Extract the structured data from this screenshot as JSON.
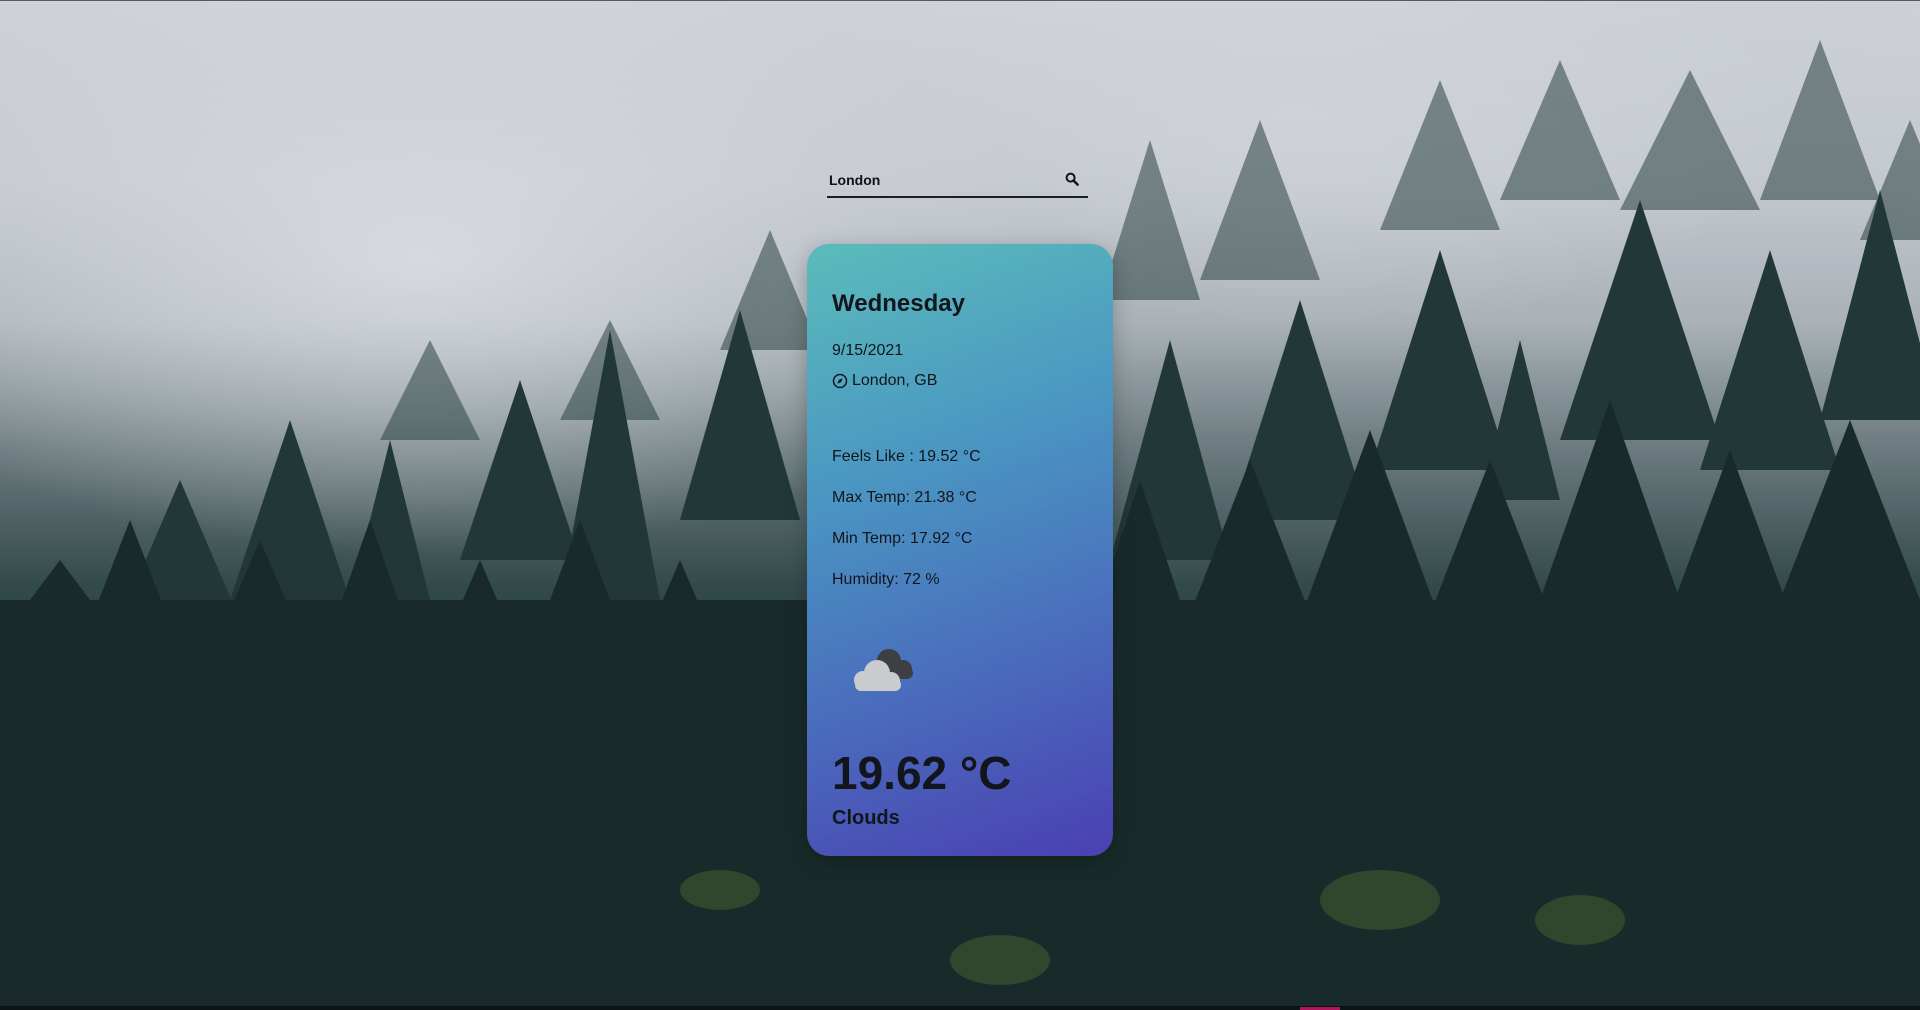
{
  "search": {
    "value": "London",
    "icon": "search-icon"
  },
  "weather": {
    "day": "Wednesday",
    "date": "9/15/2021",
    "location": "London, GB",
    "location_icon": "compass-icon",
    "feels_like": "Feels Like : 19.52 °C",
    "max_temp": "Max Temp: 21.38 °C",
    "min_temp": "Min Temp: 17.92 °C",
    "humidity": "Humidity: 72 %",
    "condition_icon": "clouds-icon",
    "temperature": "19.62 °C",
    "condition": "Clouds"
  },
  "colors": {
    "card_gradient_start": "#5bbcba",
    "card_gradient_end": "#4a40b2",
    "text": "#12161c"
  }
}
